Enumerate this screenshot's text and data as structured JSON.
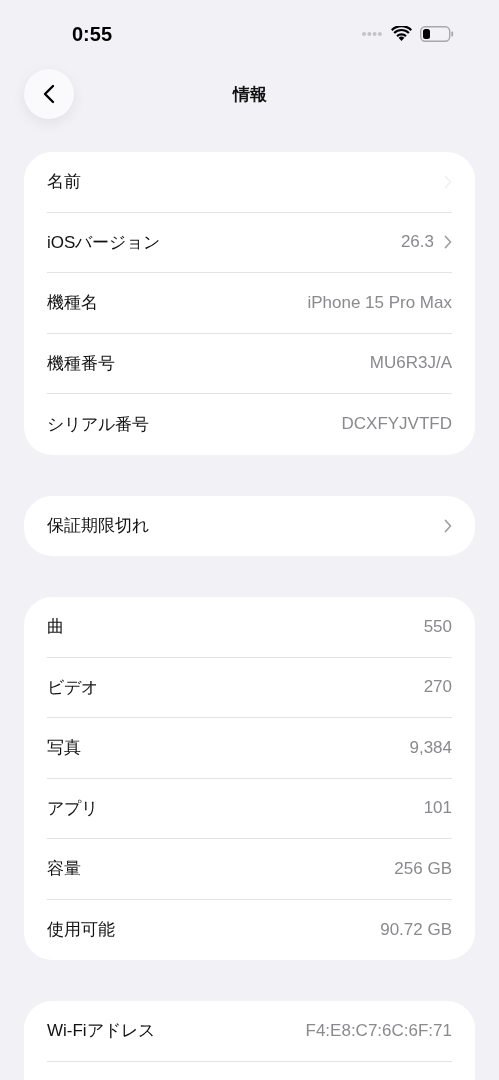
{
  "status_bar": {
    "time": "0:55"
  },
  "nav": {
    "title": "情報"
  },
  "groups": [
    {
      "rows": [
        {
          "label": "名前",
          "chevron": true,
          "dimmed": true
        },
        {
          "label": "iOSバージョン",
          "value": "26.3",
          "chevron": true,
          "dimmed": false
        },
        {
          "label": "機種名",
          "value": "iPhone 15 Pro Max"
        },
        {
          "label": "機種番号",
          "value": "MU6R3J/A"
        },
        {
          "label": "シリアル番号",
          "value": "DCXFYJVTFD"
        }
      ]
    },
    {
      "rows": [
        {
          "label": "保証期限切れ",
          "chevron": true,
          "dimmed": false
        }
      ]
    },
    {
      "rows": [
        {
          "label": "曲",
          "value": "550"
        },
        {
          "label": "ビデオ",
          "value": "270"
        },
        {
          "label": "写真",
          "value": "9,384"
        },
        {
          "label": "アプリ",
          "value": "101"
        },
        {
          "label": "容量",
          "value": "256 GB"
        },
        {
          "label": "使用可能",
          "value": "90.72 GB"
        }
      ]
    },
    {
      "rows": [
        {
          "label": "Wi-Fiアドレス",
          "value": "F4:E8:C7:6C:6F:71"
        }
      ],
      "continues": true
    }
  ]
}
